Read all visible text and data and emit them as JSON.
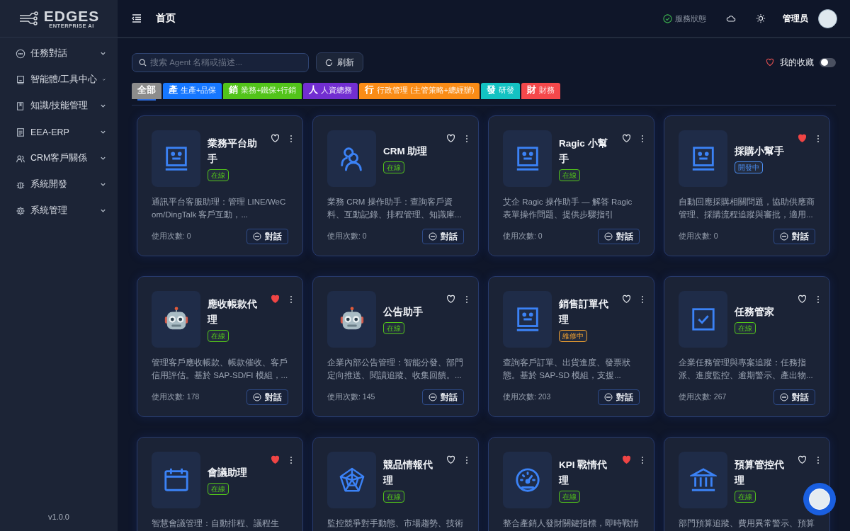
{
  "sidebar": {
    "logo": {
      "title": "EDGES",
      "subtitle": "ENTERPRISE AI"
    },
    "items": [
      {
        "label": "任務對話",
        "kind": "chat"
      },
      {
        "label": "智能體/工具中心",
        "kind": "robot"
      },
      {
        "label": "知識/技能管理",
        "kind": "book"
      },
      {
        "label": "EEA-ERP",
        "kind": "doc"
      },
      {
        "label": "CRM客戶關係",
        "kind": "users"
      },
      {
        "label": "系統開發",
        "kind": "bug"
      },
      {
        "label": "系統管理",
        "kind": "gear"
      }
    ],
    "version": "v1.0.0"
  },
  "header": {
    "title": "首页",
    "service_status": "服務狀態",
    "user": "管理员"
  },
  "toolbar": {
    "search": {
      "placeholder": "搜索 Agent 名稱或描述..."
    },
    "refresh": "刷新",
    "favorites": {
      "label": "我的收藏",
      "on": false
    }
  },
  "categories": [
    {
      "glyph": "全部",
      "color": "#8c8c8c",
      "selected": true
    },
    {
      "glyph": "產",
      "label": "生產+品保",
      "color": "#1677ff",
      "selected": false
    },
    {
      "glyph": "銷",
      "label": "業務+鐵保+行銷",
      "color": "#52c41a",
      "selected": false
    },
    {
      "glyph": "人",
      "label": "人資總務",
      "color": "#722ed1",
      "selected": false
    },
    {
      "glyph": "行",
      "label": "行政管理 (主管策略+總經辦)",
      "color": "#fa8c16",
      "selected": false
    },
    {
      "glyph": "發",
      "label": "研發",
      "color": "#13c2c2",
      "selected": false
    },
    {
      "glyph": "財",
      "label": "財務",
      "color": "#f5484b",
      "selected": false
    }
  ],
  "agents": [
    {
      "name": "業務平台助手",
      "kind": "face",
      "status": {
        "label": "在線",
        "color": "#52c41a"
      },
      "favorite": false,
      "description": "通訊平台客服助理：管理 LINE/WeCom/DingTalk 客戶互動，...",
      "usage": "使用次數: 0",
      "chat": "對話"
    },
    {
      "name": "CRM 助理",
      "kind": "users",
      "status": {
        "label": "在線",
        "color": "#52c41a"
      },
      "favorite": false,
      "description": "業務 CRM 操作助手：查詢客戶資料、互動記錄、排程管理、知識庫...",
      "usage": "使用次數: 0",
      "chat": "對話"
    },
    {
      "name": "Ragic 小幫手",
      "kind": "face",
      "status": {
        "label": "在線",
        "color": "#52c41a"
      },
      "favorite": false,
      "description": "艾企 Ragic 操作助手 — 解答 Ragic 表單操作問題、提供步驟指引",
      "usage": "使用次數: 0",
      "chat": "對話"
    },
    {
      "name": "採購小幫手",
      "kind": "face",
      "status": {
        "label": "開發中",
        "color": "#4a8cf0"
      },
      "favorite": true,
      "description": "自動回應採購相關問題，協助供應商管理、採購流程追蹤與審批，適用...",
      "usage": "使用次數: 0",
      "chat": "對話"
    },
    {
      "name": "應收帳款代理",
      "kind": "bot",
      "status": {
        "label": "在線",
        "color": "#52c41a"
      },
      "favorite": true,
      "description": "管理客戶應收帳款、帳款催收、客戶信用評估。基於 SAP-SD/FI 模組，...",
      "usage": "使用次數: 178",
      "chat": "對話"
    },
    {
      "name": "公告助手",
      "kind": "bot",
      "status": {
        "label": "在線",
        "color": "#52c41a"
      },
      "favorite": false,
      "description": "企業內部公告管理：智能分發、部門定向推送、閱讀追蹤、收集回饋。...",
      "usage": "使用次數: 145",
      "chat": "對話"
    },
    {
      "name": "銷售訂單代理",
      "kind": "face",
      "status": {
        "label": "維修中",
        "color": "#f0a030"
      },
      "favorite": false,
      "description": "查詢客戶訂單、出貨進度、發票狀態。基於 SAP-SD 模組，支援...",
      "usage": "使用次數: 203",
      "chat": "對話"
    },
    {
      "name": "任務管家",
      "kind": "check",
      "status": {
        "label": "在線",
        "color": "#52c41a"
      },
      "favorite": false,
      "description": "企業任務管理與專案追蹤：任務指派、進度監控、逾期警示、產出物...",
      "usage": "使用次數: 267",
      "chat": "對話"
    },
    {
      "name": "會議助理",
      "kind": "calendar",
      "status": {
        "label": "在線",
        "color": "#52c41a"
      },
      "favorite": true,
      "description": "智慧會議管理：自動排程、議程生"
    },
    {
      "name": "競品情報代理",
      "kind": "radar",
      "status": {
        "label": "在線",
        "color": "#52c41a"
      },
      "favorite": false,
      "description": "監控競爭對手動態、市場趨勢、技術"
    },
    {
      "name": "KPI 戰情代理",
      "kind": "gauge",
      "status": {
        "label": "在線",
        "color": "#52c41a"
      },
      "favorite": true,
      "description": "整合產銷人發財關鍵指標，即時戰情"
    },
    {
      "name": "預算管控代理",
      "kind": "bank",
      "status": {
        "label": "在線",
        "color": "#52c41a"
      },
      "favorite": false,
      "description": "部門預算追蹤、費用異常警示、預算"
    }
  ]
}
